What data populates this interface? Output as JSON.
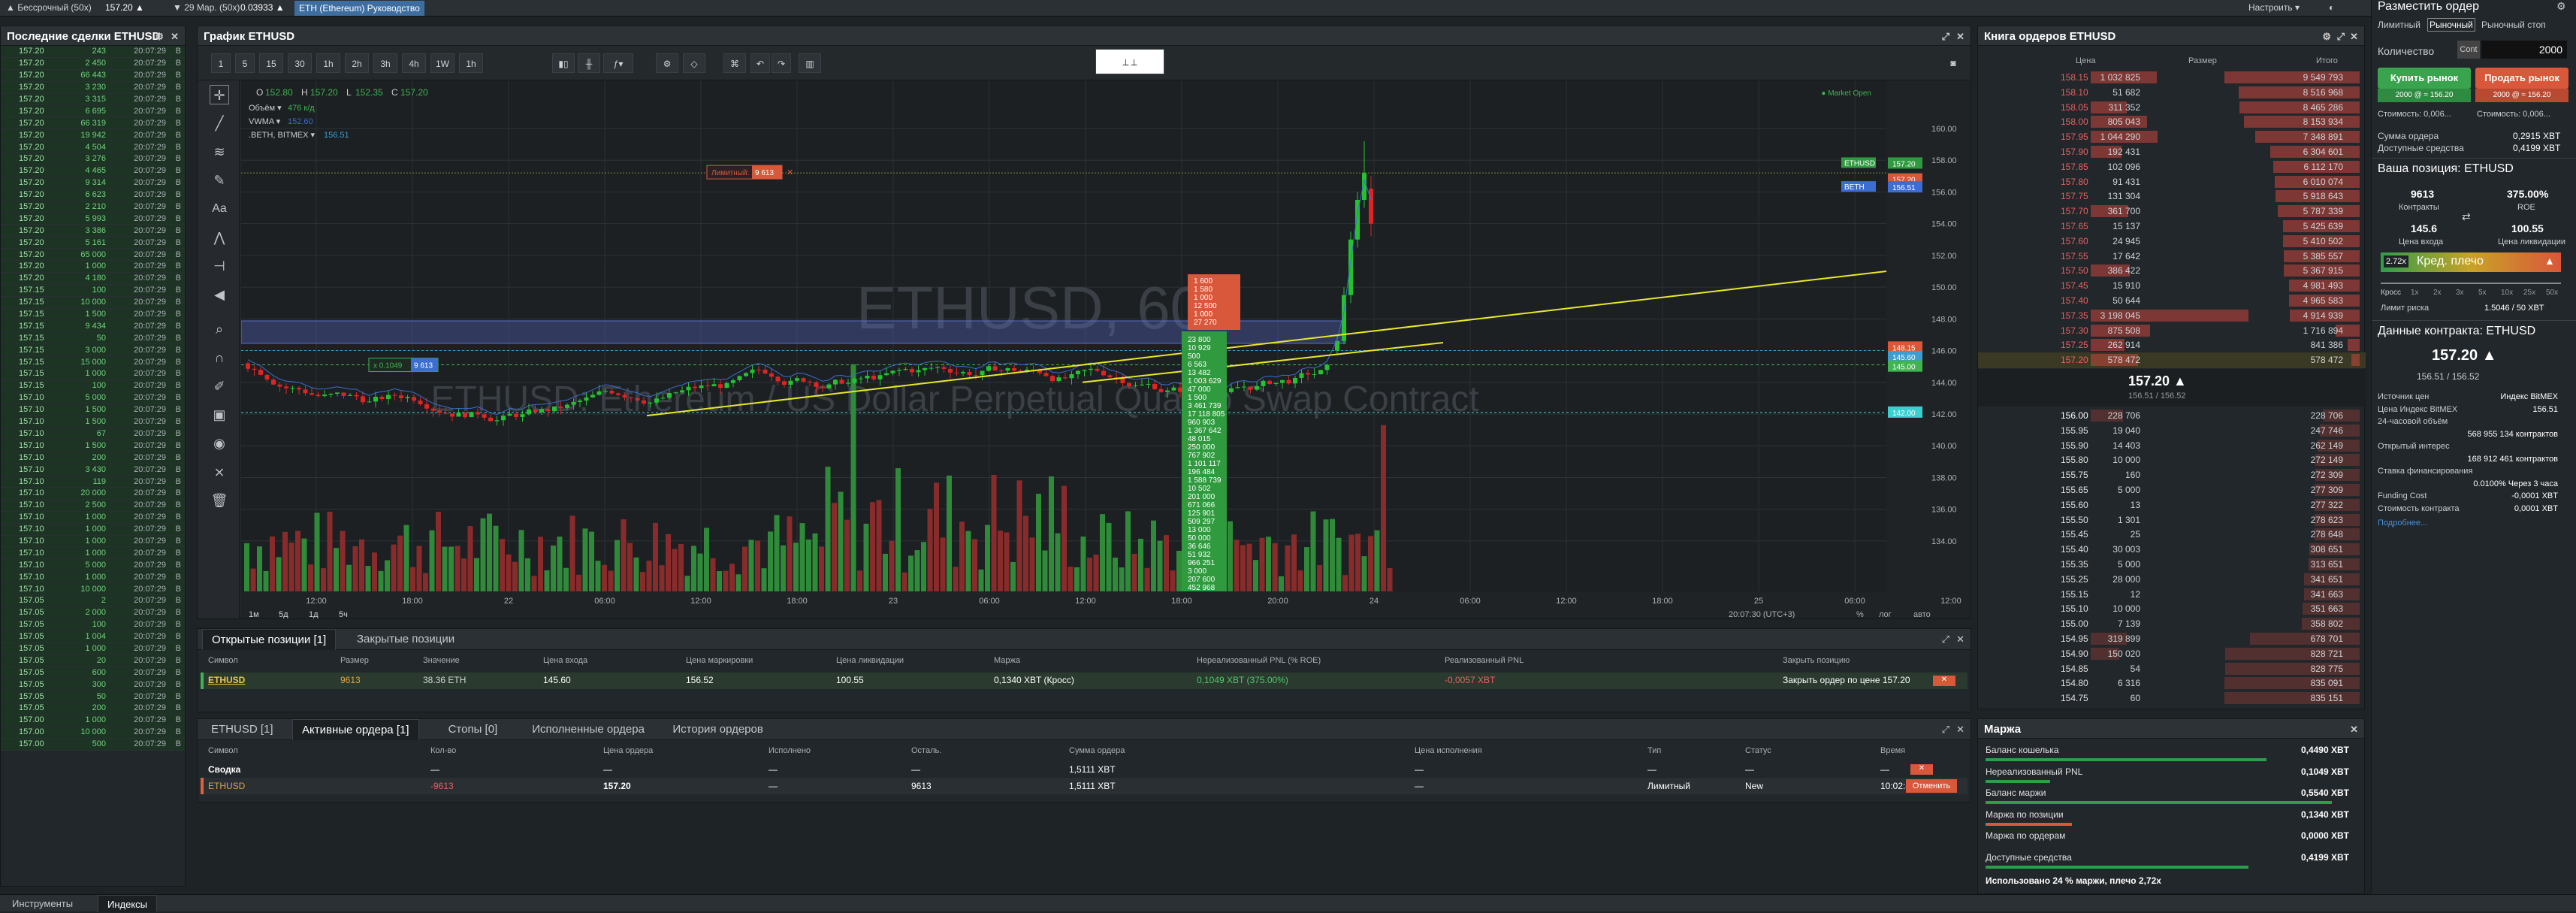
{
  "topbar": {
    "perp": "▲ Бессрочный (50x)",
    "perp_price": "157.20 ▲",
    "mar": "▼ 29 Мар. (50x)",
    "mar_price": "0.03933 ▲",
    "guide": "ETH (Ethereum) Руководство",
    "customize": "Настроить ▾"
  },
  "trades_panel": {
    "title": "Последние сделки ETHUSD",
    "rows": [
      [
        "157.20",
        "243",
        "20:07:29",
        "B",
        "g"
      ],
      [
        "157.20",
        "2 450",
        "20:07:29",
        "B",
        "g"
      ],
      [
        "157.20",
        "66 443",
        "20:07:29",
        "B",
        "g"
      ],
      [
        "157.20",
        "3 230",
        "20:07:29",
        "B",
        "g"
      ],
      [
        "157.20",
        "3 315",
        "20:07:29",
        "B",
        "g"
      ],
      [
        "157.20",
        "6 695",
        "20:07:29",
        "B",
        "g"
      ],
      [
        "157.20",
        "66 319",
        "20:07:29",
        "B",
        "g"
      ],
      [
        "157.20",
        "19 942",
        "20:07:29",
        "B",
        "g"
      ],
      [
        "157.20",
        "4 504",
        "20:07:29",
        "B",
        "g"
      ],
      [
        "157.20",
        "3 276",
        "20:07:29",
        "B",
        "g"
      ],
      [
        "157.20",
        "4 465",
        "20:07:29",
        "B",
        "g"
      ],
      [
        "157.20",
        "9 314",
        "20:07:29",
        "B",
        "g"
      ],
      [
        "157.20",
        "6 623",
        "20:07:29",
        "B",
        "g"
      ],
      [
        "157.20",
        "2 210",
        "20:07:29",
        "B",
        "g"
      ],
      [
        "157.20",
        "5 993",
        "20:07:29",
        "B",
        "g"
      ],
      [
        "157.20",
        "3 386",
        "20:07:29",
        "B",
        "g"
      ],
      [
        "157.20",
        "5 161",
        "20:07:29",
        "B",
        "g"
      ],
      [
        "157.20",
        "65 000",
        "20:07:29",
        "B",
        "g"
      ],
      [
        "157.20",
        "1 000",
        "20:07:29",
        "B",
        "g"
      ],
      [
        "157.20",
        "4 180",
        "20:07:29",
        "B",
        "g"
      ],
      [
        "157.15",
        "100",
        "20:07:29",
        "B",
        "g"
      ],
      [
        "157.15",
        "10 000",
        "20:07:29",
        "B",
        "g"
      ],
      [
        "157.15",
        "1 500",
        "20:07:29",
        "B",
        "g"
      ],
      [
        "157.15",
        "9 434",
        "20:07:29",
        "B",
        "g"
      ],
      [
        "157.15",
        "50",
        "20:07:29",
        "B",
        "g"
      ],
      [
        "157.15",
        "3 000",
        "20:07:29",
        "B",
        "g"
      ],
      [
        "157.15",
        "15 000",
        "20:07:29",
        "B",
        "g"
      ],
      [
        "157.15",
        "1 000",
        "20:07:29",
        "B",
        "g"
      ],
      [
        "157.15",
        "100",
        "20:07:29",
        "B",
        "g"
      ],
      [
        "157.10",
        "5 000",
        "20:07:29",
        "B",
        "g"
      ],
      [
        "157.10",
        "1 500",
        "20:07:29",
        "B",
        "g"
      ],
      [
        "157.10",
        "1 500",
        "20:07:29",
        "B",
        "g"
      ],
      [
        "157.10",
        "67",
        "20:07:29",
        "B",
        "g"
      ],
      [
        "157.10",
        "1 500",
        "20:07:29",
        "B",
        "g"
      ],
      [
        "157.10",
        "200",
        "20:07:29",
        "B",
        "g"
      ],
      [
        "157.10",
        "3 430",
        "20:07:29",
        "B",
        "g"
      ],
      [
        "157.10",
        "119",
        "20:07:29",
        "B",
        "g"
      ],
      [
        "157.10",
        "20 000",
        "20:07:29",
        "B",
        "g"
      ],
      [
        "157.10",
        "2 500",
        "20:07:29",
        "B",
        "g"
      ],
      [
        "157.10",
        "1 000",
        "20:07:29",
        "B",
        "g"
      ],
      [
        "157.10",
        "1 000",
        "20:07:29",
        "B",
        "g"
      ],
      [
        "157.10",
        "1 000",
        "20:07:29",
        "B",
        "g"
      ],
      [
        "157.10",
        "1 000",
        "20:07:29",
        "B",
        "g"
      ],
      [
        "157.10",
        "5 000",
        "20:07:29",
        "B",
        "g"
      ],
      [
        "157.10",
        "1 000",
        "20:07:29",
        "B",
        "g"
      ],
      [
        "157.10",
        "10 000",
        "20:07:29",
        "B",
        "g"
      ],
      [
        "157.05",
        "2",
        "20:07:29",
        "B",
        "g"
      ],
      [
        "157.05",
        "2 000",
        "20:07:29",
        "B",
        "g"
      ],
      [
        "157.05",
        "100",
        "20:07:29",
        "B",
        "g"
      ],
      [
        "157.05",
        "1 004",
        "20:07:29",
        "B",
        "g"
      ],
      [
        "157.05",
        "1 000",
        "20:07:29",
        "B",
        "g"
      ],
      [
        "157.05",
        "20",
        "20:07:29",
        "B",
        "g"
      ],
      [
        "157.05",
        "600",
        "20:07:29",
        "B",
        "g"
      ],
      [
        "157.05",
        "300",
        "20:07:29",
        "B",
        "g"
      ],
      [
        "157.05",
        "50",
        "20:07:29",
        "B",
        "g"
      ],
      [
        "157.05",
        "200",
        "20:07:29",
        "B",
        "g"
      ],
      [
        "157.00",
        "1 000",
        "20:07:29",
        "B",
        "g"
      ],
      [
        "157.00",
        "10 000",
        "20:07:29",
        "B",
        "g"
      ],
      [
        "157.00",
        "500",
        "20:07:29",
        "B",
        "g"
      ]
    ]
  },
  "chart_panel": {
    "title": "График ETHUSD",
    "ohlc": {
      "o_label": "О",
      "o": "152.80",
      "h_label": "H",
      "h": "157.20",
      "l_label": "L",
      "l": "152.35",
      "c_label": "C",
      "c": "157.20"
    },
    "volume_label": "Объём ▾",
    "volume": "476 к/д",
    "vwma_label": "VWMA ▾",
    "vwma": "152.60",
    "index_label": ".BETH, BITMEX ▾",
    "index": "156.51",
    "watermark": "ETHUSD, 60",
    "watermark_sub": "ETHUSD: Ethereum / US Dollar Perpetual Quanto Swap Contract",
    "toolbar": {
      "intervals": [
        "1",
        "5",
        "15",
        "30",
        "1h",
        "2h",
        "3h",
        "4h",
        "1W",
        "1h"
      ]
    },
    "limit_label": "Лимитный: 157.2",
    "limit_qty": "9 613",
    "limit_close": "✕",
    "pos_label": "x 0.1049",
    "pos_qty": "9 613",
    "price_axis": [
      "160.00",
      "158.00",
      "156.00",
      "154.00",
      "152.00",
      "150.00",
      "148.00",
      "146.00",
      "144.00",
      "142.00",
      "140.00",
      "138.00",
      "136.00",
      "134.00"
    ],
    "time_axis": [
      "12:00",
      "18:00",
      "22",
      "06:00",
      "12:00",
      "18:00",
      "23",
      "06:00",
      "12:00",
      "18:00",
      "20:00",
      "24",
      "06:00",
      "12:00",
      "18:00",
      "25",
      "06:00",
      "12:00"
    ],
    "tags": {
      "eth": "ETHUSD",
      "eth_price": "157.20",
      "beth": "BETH",
      "beth_price": "156.51",
      "p157": "157.20",
      "p148": "148.15",
      "p145": "145.60",
      "p142": "142.00",
      "p1455": "145.00"
    },
    "period_buttons": [
      "1м",
      "5д",
      "1д",
      "5ч"
    ],
    "bottom_right": {
      "time": "20:07:30 (UTC+3)",
      "pct": "%",
      "log": "лог",
      "auto": "авто"
    },
    "market_open": "● Market Open",
    "orders_up": [
      "1 600",
      "1 580",
      "1 000",
      "12 500",
      "1 000",
      "27 270"
    ],
    "orders_down": [
      "23 800",
      "10 929",
      "500",
      "6 563",
      "13 482",
      "1 003 629",
      "47 000",
      "1 500",
      "3 461 739",
      "17 118 805",
      "960 903",
      "1 367 642",
      "48 015",
      "250 000",
      "767 902",
      "1 101 117",
      "196 484",
      "1 588 739",
      "10 502",
      "201 000",
      "671 066",
      "125 901",
      "509 297",
      "13 000",
      "50 000",
      "36 646",
      "51 932",
      "966 251",
      "3 000",
      "207 600",
      "452 968"
    ]
  },
  "positions": {
    "tabs": [
      "Открытые позиции [1]",
      "Закрытые позиции"
    ],
    "headers": [
      "Символ",
      "Размер",
      "Значение",
      "Цена входа",
      "Цена маркировки",
      "Цена ликвидации",
      "Маржа",
      "Нереализованный PNL (% ROE)",
      "Реализованный PNL",
      "Закрыть позицию"
    ],
    "row": {
      "symbol": "ETHUSD",
      "size": "9613",
      "value": "38.36 ETH",
      "entry": "145.60",
      "mark": "156.52",
      "liq": "100.55",
      "margin": "0,1340 XBT (Кросс)",
      "upnl": "0,1049 XBT (375.00%)",
      "rpnl": "-0,0057 XBT",
      "close": "Закрыть ордер по цене 157.20"
    }
  },
  "orders": {
    "tabs": [
      "ETHUSD [1]",
      "Активные ордера [1]",
      "Стопы [0]",
      "Исполненные ордера",
      "История ордеров"
    ],
    "headers": [
      "Символ",
      "Кол-во",
      "Цена ордера",
      "Исполнено",
      "Осталь.",
      "Сумма ордера",
      "Цена исполнения",
      "Тип",
      "Статус",
      "Время"
    ],
    "summary": {
      "symbol": "Сводка",
      "qty": "—",
      "price": "—",
      "filled": "—",
      "remaining": "—",
      "value": "1,5111 XBT",
      "fillprice": "—",
      "type": "—",
      "status": "—",
      "time": "—"
    },
    "row": {
      "symbol": "ETHUSD",
      "qty": "-9613",
      "price": "157.20",
      "filled": "—",
      "remaining": "9613",
      "value": "1,5111 XBT",
      "fillprice": "—",
      "type": "Лимитный",
      "status": "New",
      "time": "10:02:45",
      "cancel": "Отменить"
    }
  },
  "orderbook": {
    "title": "Книга ордеров ETHUSD",
    "headers": [
      "Цена",
      "Размер",
      "Итого"
    ],
    "asks": [
      [
        "158.15",
        "1 032 825",
        "9 549 793"
      ],
      [
        "158.10",
        "51 682",
        "8 516 968"
      ],
      [
        "158.05",
        "311 352",
        "8 465 286"
      ],
      [
        "158.00",
        "805 043",
        "8 153 934"
      ],
      [
        "157.95",
        "1 044 290",
        "7 348 891"
      ],
      [
        "157.90",
        "192 431",
        "6 304 601"
      ],
      [
        "157.85",
        "102 096",
        "6 112 170"
      ],
      [
        "157.80",
        "91 431",
        "6 010 074"
      ],
      [
        "157.75",
        "131 304",
        "5 918 643"
      ],
      [
        "157.70",
        "361 700",
        "5 787 339"
      ],
      [
        "157.65",
        "15 137",
        "5 425 639"
      ],
      [
        "157.60",
        "24 945",
        "5 410 502"
      ],
      [
        "157.55",
        "17 642",
        "5 385 557"
      ],
      [
        "157.50",
        "386 422",
        "5 367 915"
      ],
      [
        "157.45",
        "15 910",
        "4 981 493"
      ],
      [
        "157.40",
        "50 644",
        "4 965 583"
      ],
      [
        "157.35",
        "3 198 045",
        "4 914 939"
      ],
      [
        "157.30",
        "875 508",
        "1 716 894"
      ],
      [
        "157.25",
        "262 914",
        "841 386"
      ],
      [
        "157.20",
        "578 472",
        "578 472"
      ]
    ],
    "mid": "157.20 ▲",
    "mid_sub": "156.51 / 156.52",
    "bids": [
      [
        "156.00",
        "228 706",
        "228 706"
      ],
      [
        "155.95",
        "19 040",
        "247 746"
      ],
      [
        "155.90",
        "14 403",
        "262 149"
      ],
      [
        "155.80",
        "10 000",
        "272 149"
      ],
      [
        "155.75",
        "160",
        "272 309"
      ],
      [
        "155.65",
        "5 000",
        "277 309"
      ],
      [
        "155.60",
        "13",
        "277 322"
      ],
      [
        "155.50",
        "1 301",
        "278 623"
      ],
      [
        "155.45",
        "25",
        "278 648"
      ],
      [
        "155.40",
        "30 003",
        "308 651"
      ],
      [
        "155.35",
        "5 000",
        "313 651"
      ],
      [
        "155.25",
        "28 000",
        "341 651"
      ],
      [
        "155.15",
        "12",
        "341 663"
      ],
      [
        "155.10",
        "10 000",
        "351 663"
      ],
      [
        "155.00",
        "7 139",
        "358 802"
      ],
      [
        "154.95",
        "319 899",
        "678 701"
      ],
      [
        "154.90",
        "150 020",
        "828 721"
      ],
      [
        "154.85",
        "54",
        "828 775"
      ],
      [
        "154.80",
        "6 316",
        "835 091"
      ],
      [
        "154.75",
        "60",
        "835 151"
      ]
    ]
  },
  "order_form": {
    "title": "Разместить ордер",
    "types": [
      "Лимитный",
      "Рыночный",
      "Рыночный стоп"
    ],
    "qty_label": "Количество",
    "qty_unit": "Cont",
    "qty": "2000",
    "buy": "Купить рынок",
    "sell": "Продать рынок",
    "buy_sub": "2000 @ ≈ 156.20",
    "sell_sub": "2000 @ ≈ 156.20",
    "cost_buy": "Стоимость: 0,006...",
    "cost_sell": "Стоимость: 0,006...",
    "order_value_label": "Сумма ордера",
    "order_value": "0,2915 XBT",
    "available_label": "Доступные средства",
    "available": "0,4199 XBT"
  },
  "your_position": {
    "title": "Ваша позиция: ETHUSD",
    "contracts": "9613",
    "contracts_label": "Контракты",
    "roe": "375.00%",
    "roe_label": "ROE",
    "entry": "145.6",
    "entry_label": "Цена входа",
    "liq": "100.55",
    "liq_label": "Цена ликвидации",
    "lev_badge": "2.72x",
    "lev_text": "Крeд. плечо",
    "cross": "Кросс",
    "ticks": [
      "1x",
      "2x",
      "3x",
      "5x",
      "10x",
      "25x",
      "50x"
    ],
    "risk_label": "Лимит риска",
    "risk": "1.5046 / 50 XBT"
  },
  "contract": {
    "title": "Данные контракта: ETHUSD",
    "price": "157.20 ▲",
    "sub": "156.51 / 156.52",
    "rows": [
      [
        "Источник цен",
        "Индекс BitMEX"
      ],
      [
        "Цена Индекс BitMEX",
        "156.51"
      ],
      [
        "24-часовой объём",
        ""
      ],
      [
        "",
        "568 955 134 контрактов"
      ],
      [
        "Открытый интерес",
        ""
      ],
      [
        "",
        "168 912 461 контрактов"
      ],
      [
        "Ставка финансирования",
        ""
      ],
      [
        "",
        "0.0100% Через 3 часа"
      ],
      [
        "Funding Cost",
        "-0,0001 XBT"
      ],
      [
        "Стоимость контракта",
        "0,0001 XBT"
      ]
    ],
    "more": "Подробнее..."
  },
  "margin": {
    "title": "Маржа",
    "rows": [
      [
        "Баланс кошелька",
        "0,4490 XBT",
        0.78
      ],
      [
        "Нереализованный PNL",
        "0,1049 XBT",
        0.18
      ],
      [
        "Баланс маржи",
        "0,5540 XBT",
        0.96
      ],
      [
        "Маржа по позиции",
        "0,1340 XBT",
        0.24
      ],
      [
        "Маржа по ордерам",
        "0,0000 XBT",
        0
      ],
      [
        "Доступные средства",
        "0,4199 XBT",
        0.73
      ]
    ],
    "footer": "Использовано 24 % маржи, плечо 2,72x"
  },
  "bottom_tabs": [
    "Инструменты",
    "Индексы"
  ]
}
